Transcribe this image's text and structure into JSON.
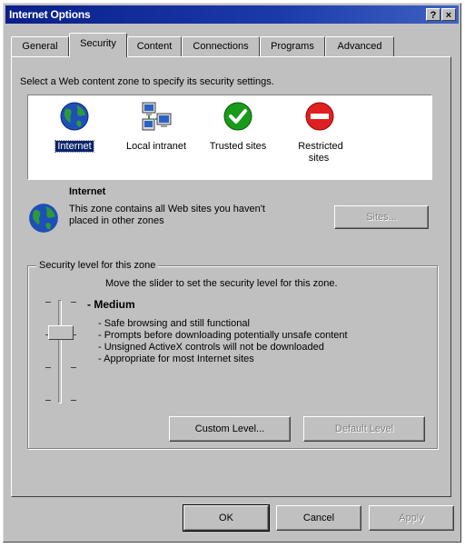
{
  "window": {
    "title": "Internet Options",
    "help_glyph": "?",
    "close_glyph": "×"
  },
  "tabs": [
    {
      "label": "General"
    },
    {
      "label": "Security"
    },
    {
      "label": "Content"
    },
    {
      "label": "Connections"
    },
    {
      "label": "Programs"
    },
    {
      "label": "Advanced"
    }
  ],
  "active_tab": "Security",
  "security": {
    "instruction": "Select a Web content zone to specify its security settings.",
    "zones": [
      {
        "label": "Internet",
        "icon": "globe-icon",
        "selected": true
      },
      {
        "label": "Local intranet",
        "icon": "network-computers-icon",
        "selected": false
      },
      {
        "label": "Trusted sites",
        "icon": "checkmark-circle-icon",
        "selected": false
      },
      {
        "label": "Restricted sites",
        "icon": "no-entry-circle-icon",
        "selected": false
      }
    ],
    "selected_zone": {
      "name": "Internet",
      "description": "This zone contains all Web sites you haven't placed in other zones",
      "sites_button": "Sites..."
    },
    "level_group": {
      "legend": "Security level for this zone",
      "instruction": "Move the slider to set the security level for this zone.",
      "level_name": "- Medium",
      "level_items": [
        "- Safe browsing and still functional",
        "- Prompts before downloading potentially unsafe content",
        "- Unsigned ActiveX controls will not be downloaded",
        "- Appropriate for most Internet sites"
      ],
      "slider_level": 0.75,
      "custom_button": "Custom Level...",
      "default_button": "Default Level"
    }
  },
  "footer": {
    "ok": "OK",
    "cancel": "Cancel",
    "apply": "Apply"
  },
  "colors": {
    "titlebar_start": "#0a1f8a",
    "titlebar_end": "#3f62c4",
    "face": "#c0c0c0",
    "selection": "#0a246a",
    "trusted_green": "#1a9a1a",
    "restricted_red": "#e02020"
  }
}
